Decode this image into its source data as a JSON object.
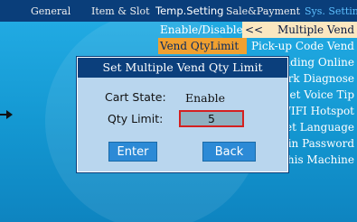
{
  "tabs": [
    "General",
    "Item & Slot",
    "Temp.Setting",
    "Sale&Payment",
    "Sys. Setting"
  ],
  "menu_left": [
    "Enable/Disable",
    "Vend QtyLimit"
  ],
  "menu_right_selected": {
    "arrow": "<<",
    "label": "Multiple Vend"
  },
  "menu_right": [
    "Pick-up Code Vend",
    "Holding Online",
    "Network Diagnose",
    "Set Voice Tip",
    "WIFI Hotspot",
    "Set Language",
    "Admin Password",
    "About This Machine"
  ],
  "dialog": {
    "title": "Set Multiple Vend Qty Limit",
    "cart_state_label": "Cart State:",
    "cart_state_value": "Enable",
    "qty_limit_label": "Qty Limit:",
    "qty_limit_value": "5",
    "enter_label": "Enter",
    "back_label": "Back"
  },
  "icons": {
    "left_arrow": "arrow-right-icon"
  },
  "colors": {
    "topbar": "#0a3e7a",
    "selected_item": "#f0a030",
    "dialog_bg": "#b9d6ee",
    "button": "#2c8ad6",
    "field_border": "#d42020"
  }
}
